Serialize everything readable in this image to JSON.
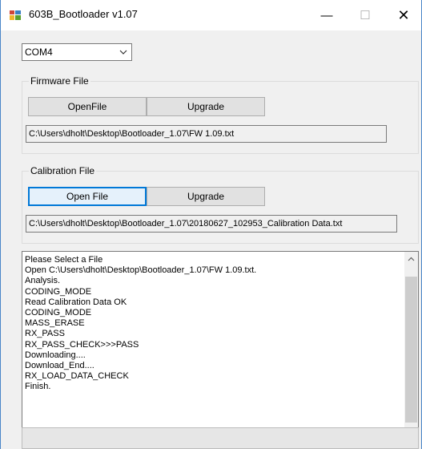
{
  "window": {
    "title": "603B_Bootloader v1.07"
  },
  "titlebar_buttons": {
    "minimize": "—",
    "maximize": "☐",
    "close": "✕"
  },
  "port": {
    "selected": "COM4"
  },
  "firmware": {
    "group_label": "Firmware File",
    "open_label": "OpenFile",
    "upgrade_label": "Upgrade",
    "path": "C:\\Users\\dholt\\Desktop\\Bootloader_1.07\\FW 1.09.txt"
  },
  "calibration": {
    "group_label": "Calibration File",
    "open_label": "Open File",
    "upgrade_label": "Upgrade",
    "path": "C:\\Users\\dholt\\Desktop\\Bootloader_1.07\\20180627_102953_Calibration Data.txt"
  },
  "log": {
    "lines": [
      "Please Select a File",
      "Open C:\\Users\\dholt\\Desktop\\Bootloader_1.07\\FW 1.09.txt.",
      "Analysis.",
      "CODING_MODE",
      "Read Calibration Data OK",
      "CODING_MODE",
      "MASS_ERASE",
      "RX_PASS",
      "RX_PASS_CHECK>>>PASS",
      "Downloading....",
      "Download_End....",
      "RX_LOAD_DATA_CHECK",
      "Finish."
    ]
  },
  "status": {
    "text": ""
  }
}
